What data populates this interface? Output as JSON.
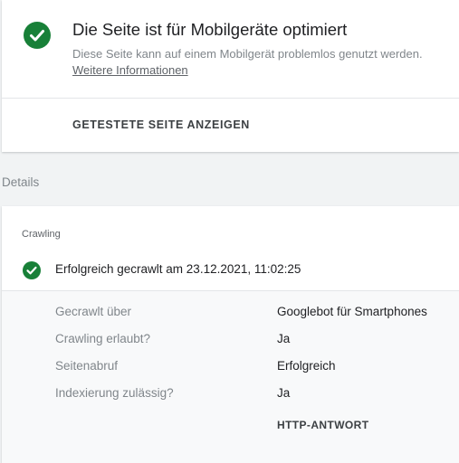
{
  "result": {
    "title": "Die Seite ist für Mobilgeräte optimiert",
    "description": "Diese Seite kann auf einem Mobilgerät problemlos genutzt werden.",
    "link_label": "Weitere Informationen",
    "view_tested_page_label": "GETESTETE SEITE ANZEIGEN",
    "status_icon": "check-circle-icon",
    "status_color": "#188038"
  },
  "details": {
    "heading": "Details",
    "crawling": {
      "section_title": "Crawling",
      "status_icon": "check-circle-icon",
      "status_text": "Erfolgreich gecrawlt am 23.12.2021, 11:02:25",
      "rows": [
        {
          "label": "Gecrawlt über",
          "value": "Googlebot für Smartphones"
        },
        {
          "label": "Crawling erlaubt?",
          "value": "Ja"
        },
        {
          "label": "Seitenabruf",
          "value": "Erfolgreich"
        },
        {
          "label": "Indexierung zulässig?",
          "value": "Ja"
        }
      ],
      "http_response_label": "HTTP-ANTWORT"
    }
  }
}
